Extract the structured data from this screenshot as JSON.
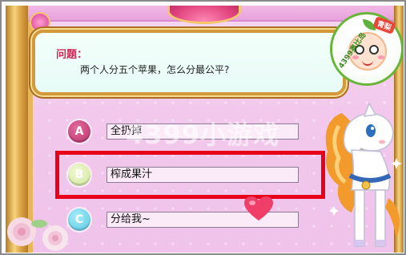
{
  "question": {
    "label": "问题：",
    "text": "两个人分五个苹果，怎么分最公平?"
  },
  "logo": {
    "text": "4399奥比岛",
    "tag": "青梨"
  },
  "watermark": "4399小游戏",
  "options": [
    {
      "letter": "A",
      "text": "全扔掉"
    },
    {
      "letter": "B",
      "text": "榨成果汁"
    },
    {
      "letter": "C",
      "text": "分给我~"
    }
  ],
  "selected_option": "B",
  "colors": {
    "highlight": "#e8001b",
    "question_label": "#cc2a54",
    "option_a": "#b8336c",
    "option_b": "#cde59a",
    "option_c": "#56c8e4"
  }
}
